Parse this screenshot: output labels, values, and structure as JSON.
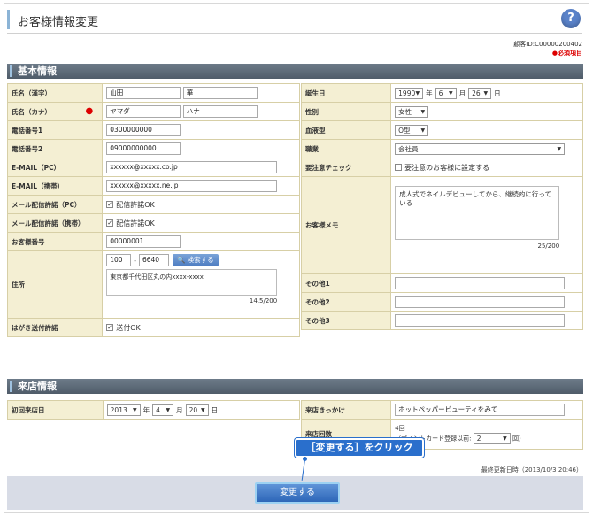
{
  "header": {
    "title": "お客様情報変更",
    "help_icon": "question-icon"
  },
  "meta": {
    "customer_id": "顧客ID:C00000200402",
    "required_note": "●必須項目"
  },
  "sections": {
    "basic": "基本情報",
    "visit": "来店情報"
  },
  "basic_left": {
    "name_kanji": {
      "label": "氏名（漢字）",
      "last": "山田",
      "first": "華"
    },
    "name_kana": {
      "label": "氏名（カナ）",
      "required_mark": "●",
      "last": "ヤマダ",
      "first": "ハナ"
    },
    "phone1": {
      "label": "電話番号1",
      "value": "0300000000"
    },
    "phone2": {
      "label": "電話番号2",
      "value": "09000000000"
    },
    "email_pc": {
      "label": "E-MAIL（PC）",
      "value": "xxxxxx@xxxxx.co.jp"
    },
    "email_mobile": {
      "label": "E-MAIL（携帯）",
      "value": "xxxxxx@xxxxx.ne.jp"
    },
    "mail_pc": {
      "label": "メール配信許諾（PC）",
      "option": "配信許諾OK",
      "checked": true
    },
    "mail_mobile": {
      "label": "メール配信許諾（携帯）",
      "option": "配信許諾OK",
      "checked": true
    },
    "customer_no": {
      "label": "お客様番号",
      "value": "00000001"
    },
    "address": {
      "label": "住所",
      "zip1": "100",
      "dash": "-",
      "zip2": "6640",
      "search_label": "検索する",
      "value": "東京都千代田区丸の内xxxx-xxxx",
      "counter": "14.5/200"
    },
    "postcard": {
      "label": "はがき送付許諾",
      "option": "送付OK",
      "checked": true
    }
  },
  "basic_right": {
    "birthday": {
      "label": "誕生日",
      "year": "1990",
      "year_unit": "年",
      "month": "6",
      "month_unit": "月",
      "day": "26",
      "day_unit": "日"
    },
    "gender": {
      "label": "性別",
      "value": "女性"
    },
    "blood": {
      "label": "血液型",
      "value": "O型"
    },
    "job": {
      "label": "職業",
      "value": "会社員"
    },
    "attention": {
      "label": "要注意チェック",
      "option": "要注意のお客様に設定する",
      "checked": false
    },
    "memo": {
      "label": "お客様メモ",
      "value": "成人式でネイルデビューしてから、継続的に行っている",
      "counter": "25/200"
    },
    "other1": {
      "label": "その他1",
      "value": ""
    },
    "other2": {
      "label": "その他2",
      "value": ""
    },
    "other3": {
      "label": "その他3",
      "value": ""
    }
  },
  "visit": {
    "first_visit": {
      "label": "初回来店日",
      "year": "2013",
      "year_unit": "年",
      "month": "4",
      "month_unit": "月",
      "day": "20",
      "day_unit": "日"
    },
    "trigger": {
      "label": "来店きっかけ",
      "value": "ホットペッパービューティをみて"
    },
    "count": {
      "label": "来店回数",
      "value": "4回",
      "pre_note": "（ポイントカード登録以前:",
      "pre_value": "2",
      "pre_suffix": "回）"
    }
  },
  "footer": {
    "updated": "最終更新日時（2013/10/3 20:46）",
    "change_button": "変更する"
  },
  "callout": {
    "text": "［変更する］をクリック"
  }
}
